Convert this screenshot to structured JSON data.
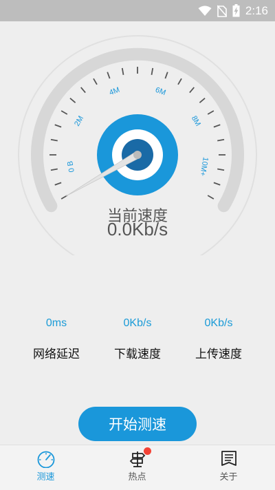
{
  "status_bar": {
    "time": "2:16"
  },
  "gauge": {
    "scale_labels": [
      "0 B",
      "2M",
      "4M",
      "6M",
      "8M",
      "10M+"
    ],
    "title": "当前速度",
    "current_speed": "0.0Kb/s",
    "needle_fraction": 0
  },
  "stats": [
    {
      "value": "0ms",
      "label": "网络延迟"
    },
    {
      "value": "0Kb/s",
      "label": "下载速度"
    },
    {
      "value": "0Kb/s",
      "label": "上传速度"
    }
  ],
  "start_button": {
    "label": "开始测速"
  },
  "tabs": [
    {
      "label": "测速",
      "icon": "speedometer-icon",
      "active": true
    },
    {
      "label": "热点",
      "icon": "signpost-icon",
      "active": false,
      "badge": true
    },
    {
      "label": "关于",
      "icon": "document-icon",
      "active": false
    }
  ],
  "colors": {
    "accent": "#1a97da",
    "dark_blue": "#1a6aa6",
    "badge": "#f44336"
  }
}
